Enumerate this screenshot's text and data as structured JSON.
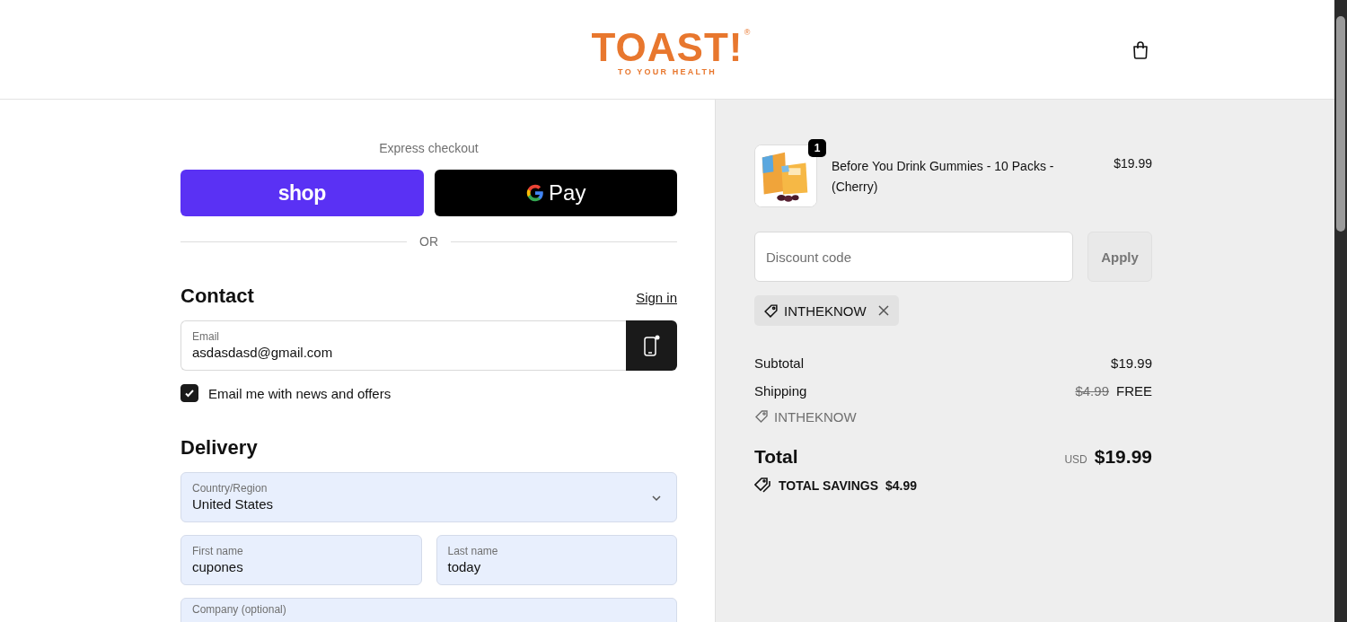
{
  "header": {
    "logo": {
      "wordmark": "TOAST!",
      "registered": "®",
      "tagline": "TO YOUR HEALTH"
    }
  },
  "express_checkout": {
    "title": "Express checkout",
    "buttons": [
      {
        "kind": "shop",
        "label": "shop"
      },
      {
        "kind": "gpay",
        "label": "Pay"
      }
    ],
    "divider": "OR"
  },
  "contact": {
    "heading": "Contact",
    "sign_in": "Sign in",
    "email": {
      "label": "Email",
      "value": "asdasdasd@gmail.com"
    },
    "newsletter": {
      "label": "Email me with news and offers",
      "checked": true
    }
  },
  "delivery": {
    "heading": "Delivery",
    "rows": [
      {
        "fields": [
          {
            "kind": "select",
            "label": "Country/Region",
            "value": "United States"
          }
        ]
      },
      {
        "fields": [
          {
            "kind": "text",
            "label": "First name",
            "value": "cupones"
          },
          {
            "kind": "text",
            "label": "Last name",
            "value": "today"
          }
        ]
      },
      {
        "fields": [
          {
            "kind": "text",
            "label": "Company (optional)"
          }
        ]
      }
    ]
  },
  "order_summary": {
    "items": [
      {
        "quantity": "1",
        "name": "Before You Drink Gummies - 10 Packs - (Cherry)",
        "price": "$19.99"
      }
    ],
    "discount": {
      "placeholder": "Discount code",
      "button": "Apply",
      "disabled": true
    },
    "applied_codes": [
      {
        "code": "INTHEKNOW"
      }
    ],
    "subtotal": {
      "label": "Subtotal",
      "value": "$19.99"
    },
    "shipping": {
      "label": "Shipping",
      "original": "$4.99",
      "value": "FREE",
      "discount_code": "INTHEKNOW"
    },
    "total": {
      "label": "Total",
      "currency": "USD",
      "value": "$19.99"
    },
    "savings": {
      "label": "TOTAL SAVINGS",
      "value": "$4.99"
    }
  }
}
